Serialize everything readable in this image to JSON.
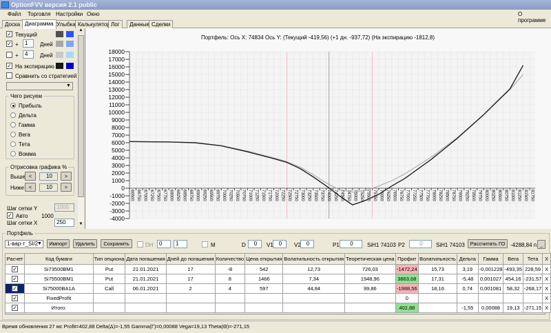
{
  "window": {
    "title": "OptionFVV версия 2.1 public"
  },
  "menu": {
    "items": [
      "Файл",
      "Торговля",
      "Настройки",
      "Окно"
    ],
    "about": "О программе"
  },
  "tabs": [
    {
      "label": "Доска"
    },
    {
      "label": "Диаграмма",
      "active": true
    },
    {
      "label": "Улыбка"
    },
    {
      "label": "Калькулятор"
    },
    {
      "label": "Лог"
    },
    {
      "label": "Данные"
    },
    {
      "label": "Сделки"
    }
  ],
  "left": {
    "current_label": "Текущий",
    "current_checked": true,
    "current_colors": [
      "#505050",
      "#2a52ff"
    ],
    "plus_label": "+",
    "days_label": "Дней",
    "plus1_value": "1",
    "plus1_checked": true,
    "plus1_colors": [
      "#a8a8a8",
      "#7aa8ff"
    ],
    "plus2_value": "4",
    "plus2_checked": false,
    "plus2_colors": [
      "#c8c8c8",
      "#a8d8ff"
    ],
    "expiry_label": "На экспирацию",
    "expiry_checked": true,
    "expiry_colors": [
      "#1a1a1a",
      "#0000c8"
    ],
    "compare_label": "Сравнить со стратегией",
    "compare_checked": false,
    "what_group": "Чего рисуем",
    "radios": [
      {
        "label": "Прибыль",
        "selected": true
      },
      {
        "label": "Дельта"
      },
      {
        "label": "Гамма"
      },
      {
        "label": "Вега"
      },
      {
        "label": "Тета"
      },
      {
        "label": "Вомма"
      }
    ],
    "draw_group": "Отрисовка графика %",
    "above_label": "Выше",
    "above_value": "10",
    "below_label": "Ниже",
    "below_value": "10",
    "prev": "<",
    "next": ">",
    "grid_y_label": "Шаг сетки Y",
    "grid_y_value": "1000",
    "auto_label": "Авто",
    "auto_checked": true,
    "auto_value": "1000",
    "grid_x_label": "Шаг сетки X",
    "grid_x_value": "250"
  },
  "chart_caption": "Портфель: Ось X: 74834 Ось Y:  (Текущий -419,56)  (+1 дн. -937,72)  (На экспирацию -1812,8)",
  "chart_data": {
    "type": "line",
    "xlim": [
      66500,
      81750
    ],
    "ylim": [
      -4000,
      18000
    ],
    "x_ticks": [
      66500,
      66750,
      67000,
      67250,
      67500,
      67750,
      68000,
      68250,
      68500,
      68750,
      69000,
      69250,
      69500,
      69750,
      70000,
      70250,
      70500,
      70750,
      71000,
      71250,
      71500,
      71750,
      72000,
      72250,
      72500,
      72750,
      73000,
      73250,
      73500,
      73750,
      74000,
      74250,
      74500,
      74750,
      75000,
      75250,
      75500,
      75750,
      76000,
      76250,
      76500,
      76750,
      77000,
      77250,
      77500,
      77750,
      78000,
      78250,
      78500,
      78750,
      79000,
      79250,
      79500,
      79750,
      80000,
      80250,
      80500,
      80750,
      81000,
      81250,
      81500,
      81750
    ],
    "y_ticks": [
      -4000,
      -3000,
      -2000,
      -1000,
      0,
      1000,
      2000,
      3000,
      4000,
      5000,
      6000,
      7000,
      8000,
      9000,
      10000,
      11000,
      12000,
      13000,
      14000,
      15000,
      16000,
      17000,
      18000
    ],
    "grid": true,
    "vlines": [
      {
        "x": 74103,
        "color": "#a0a0a0"
      },
      {
        "x": 72500,
        "color": "#f4b8c0"
      },
      {
        "x": 75750,
        "color": "#f4b8c0"
      }
    ],
    "series": [
      {
        "color": "#b0b0b0",
        "x": [
          66500,
          68000,
          69000,
          70000,
          71000,
          72000,
          72500,
          73000,
          73500,
          74000,
          74500,
          75000,
          75500,
          76000,
          76500,
          77000,
          78000,
          79000,
          80000,
          81000,
          81500
        ],
        "y": [
          6150,
          6100,
          6000,
          5600,
          4900,
          4000,
          3500,
          2800,
          1800,
          700,
          -200,
          -500,
          -300,
          300,
          1000,
          1900,
          4100,
          6700,
          9700,
          13000,
          15000
        ]
      },
      {
        "color": "#202020",
        "x": [
          66500,
          68000,
          69000,
          70000,
          71000,
          72000,
          72500,
          73000,
          73500,
          74000,
          74500,
          75000,
          75500,
          76000,
          76500,
          77000,
          78000,
          79000,
          80000,
          81000,
          81500
        ],
        "y": [
          6150,
          6100,
          6000,
          5600,
          4800,
          3900,
          3400,
          2600,
          1500,
          300,
          -1000,
          -2200,
          -1600,
          -800,
          300,
          1300,
          3800,
          6600,
          9700,
          13100,
          16200
        ]
      }
    ]
  },
  "portfolio": {
    "group": "Портфель",
    "select": "1-вар-т_SI/2",
    "import": "Импорт",
    "delete": "Удалить",
    "save": "Сохранить",
    "dh_label": "DH",
    "spin1": "0",
    "spin2": "1",
    "m_label": "M",
    "d_label": "D",
    "d_value": "0",
    "v1_label": "V1",
    "v1_value": "0",
    "v2_label": "V2",
    "v2_value": "0",
    "p1_label": "P1",
    "p1_value": "0",
    "p1_instr": "SiH1 74103",
    "p2_label": "P2",
    "p2_value": "0",
    "p2_instr": "SiH1 74103",
    "calc_go": "Рассчитать ГО",
    "go_value": "-4288,84 п.",
    "minimize": "_",
    "columns": [
      "Расчет",
      "Код бумаги",
      "Тип опциона",
      "Дата погашения",
      "Дней до погашения",
      "Количество",
      "Цена открытия",
      "Волатильность открытия",
      "Теоретическая цена",
      "Профит",
      "Волатильность",
      "Дельта",
      "Гамма",
      "Вега",
      "Тета",
      "X"
    ],
    "rows": [
      [
        "",
        "Si73500BM1",
        "Put",
        "21.01.2021",
        "17",
        "-8",
        "542",
        "12,73",
        "726,03",
        "-1472,24",
        "15,73",
        "3,19",
        "-0,001228",
        "-493,35",
        "228,59",
        "X"
      ],
      [
        "",
        "Si75500BM1",
        "Put",
        "21.01.2021",
        "17",
        "8",
        "1466",
        "7,34",
        "1948,96",
        "3863,68",
        "17,31",
        "-5,48",
        "0,001027",
        "454,16",
        "-231,57",
        "X"
      ],
      [
        "",
        "Si75000BA1A",
        "Call",
        "06.01.2021",
        "2",
        "4",
        "597",
        "44,84",
        "99,86",
        "-1988,56",
        "18,16",
        "0,74",
        "0,001081",
        "58,32",
        "-268,17",
        "X"
      ],
      [
        "",
        "FixedProfit",
        "",
        "",
        "",
        "",
        "",
        "",
        "",
        "0",
        "",
        "",
        "",
        "",
        "",
        "X"
      ],
      [
        "",
        "Итого:",
        "",
        "",
        "",
        "",
        "",
        "",
        "",
        "402,88",
        "",
        "-1,55",
        "0,00088",
        "19,13",
        "-271,15",
        "X"
      ]
    ],
    "profit_status": [
      "neg",
      "pos",
      "neg",
      "",
      "pos"
    ]
  },
  "status": "Время обновления 27 мс  Profit=402,88 Delta(Δ)=-1,55 Gamma(Γ)=0,00088 Vega=19,13 Theta(Θ)=-271,15"
}
